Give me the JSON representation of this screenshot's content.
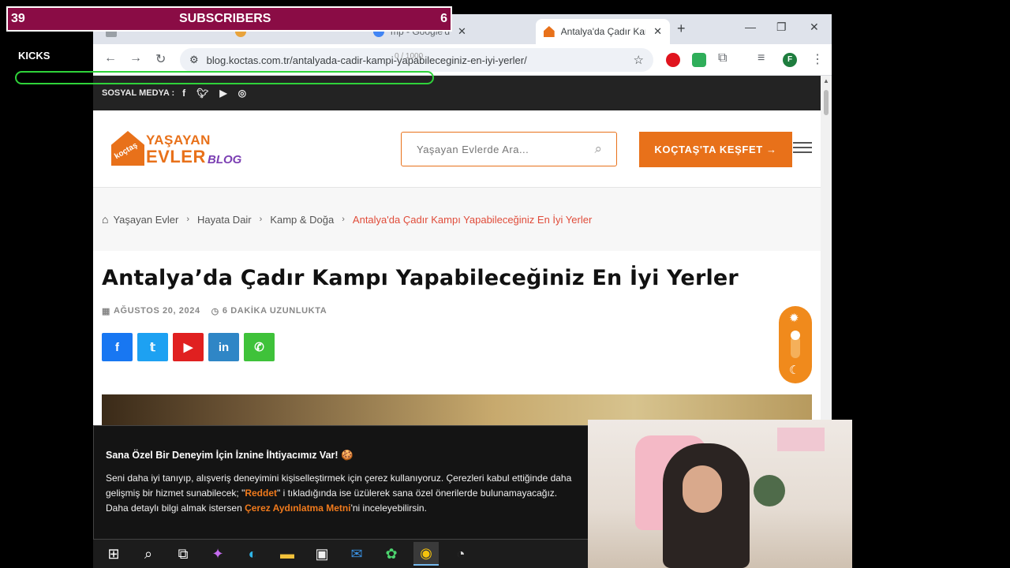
{
  "overlay": {
    "subscribers_count": "39",
    "subscribers_label": "SUBSCRIBERS",
    "subscribers_goal": "6",
    "kicks_label": "KICKS",
    "kicks_count": "0 / 1000",
    "kicks_progress": 0,
    "bar_color": "#2fd33a",
    "banner_color": "#8a0c45"
  },
  "browser": {
    "tabs": [
      {
        "label": "",
        "favicon": "doc-icon"
      },
      {
        "label": "",
        "favicon": "globe-icon"
      },
      {
        "label": "mp - Google'd",
        "favicon": "google-icon"
      },
      {
        "label": "Antalya'da Çadır Kamp",
        "favicon": "koctas-icon",
        "active": true
      }
    ],
    "url": "blog.koctas.com.tr/antalyada-cadir-kampi-yapabileceginiz-en-iyi-yerler/",
    "profile_initial": "F"
  },
  "site": {
    "social_label": "SOSYAL MEDYA :",
    "logo": {
      "line1": "YAŞAYAN",
      "line2": "EVLER",
      "line3": "BLOG",
      "badge": "koçtaş"
    },
    "search_placeholder": "Yaşayan Evlerde Ara...",
    "cta_label": "KOÇTAŞ'TA KEŞFET →",
    "accent": "#e8711a",
    "breadcrumb": [
      "Yaşayan Evler",
      "Hayata Dair",
      "Kamp & Doğa",
      "Antalya'da Çadır Kampı Yapabileceğiniz En İyi Yerler"
    ],
    "title": "Antalya’da Çadır Kampı Yapabileceğiniz En İyi Yerler",
    "date": "AĞUSTOS 20, 2024",
    "read_time": "6 DAKİKA UZUNLUKTA",
    "share": [
      {
        "name": "facebook",
        "glyph": "f",
        "color": "#1877f2"
      },
      {
        "name": "twitter",
        "glyph": "𝕥",
        "color": "#1da1f2"
      },
      {
        "name": "youtube",
        "glyph": "▶",
        "color": "#e02020"
      },
      {
        "name": "linkedin",
        "glyph": "in",
        "color": "#2f86c6"
      },
      {
        "name": "whatsapp",
        "glyph": "✆",
        "color": "#3fc23a"
      }
    ]
  },
  "cookie": {
    "heading": "Sana Özel Bir Deneyim İçin İznine İhtiyacımız Var! 🍪",
    "text_1": "Seni daha iyi tanıyıp, alışveriş deneyimini kişiselleştirmek için çerez kullanıyoruz. Çerezleri kabul ettiğinde daha gelişmiş bir hizmet sunabilecek; \"",
    "reject": "Reddet",
    "text_2": "\" i tıkladığında ise üzülerek sana özel önerilerde bulunamayacağız. Daha detaylı bilgi almak istersen ",
    "policy": "Çerez Aydınlatma Metni",
    "text_3": "'ni inceleyebilirsin."
  },
  "taskbar": [
    "start-icon",
    "search-icon",
    "taskview-icon",
    "copilot-icon",
    "edge-icon",
    "explorer-icon",
    "store-icon",
    "mail-icon",
    "app-icon",
    "chrome-icon",
    "obs-icon"
  ]
}
